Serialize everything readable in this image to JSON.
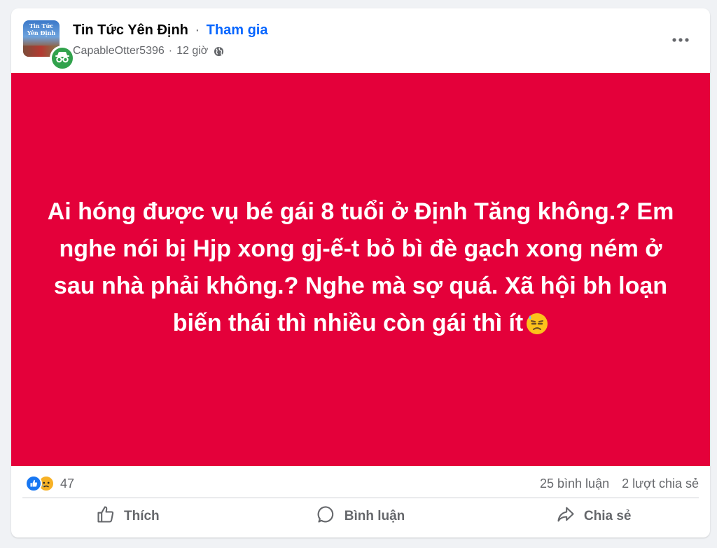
{
  "header": {
    "group_name": "Tin Tức Yên Định",
    "separator": "·",
    "join_label": "Tham gia",
    "group_avatar_text": "Tin Tức Yên Định",
    "author": "CapableOtter5396",
    "time": "12 giờ",
    "author_avatar_icon": "anonymous-incognito-icon",
    "privacy_icon": "globe-icon",
    "more_icon": "more-horizontal-icon"
  },
  "post": {
    "lines": [
      "Ai hóng được vụ bé gái 8 tuổi ở Định Tăng không.? Em",
      "nghe nói bị Hjp xong gj-ế-t bỏ bì đè gạch xong ném ở",
      "sau nhà phải không.? Nghe mà sợ quá. Xã hội bh loạn",
      "biến thái thì nhiều còn gái thì ít"
    ],
    "emoji": "downcast-face-with-sweat-emoji",
    "background_color": "#e4003a"
  },
  "stats": {
    "reaction_icons": [
      "like-icon",
      "sad-icon"
    ],
    "reaction_count": "47",
    "comments": "25 bình luận",
    "shares": "2 lượt chia sẻ"
  },
  "actions": {
    "like": "Thích",
    "comment": "Bình luận",
    "share": "Chia sẻ"
  },
  "colors": {
    "accent": "#0866ff",
    "secondary_text": "#65676b",
    "page_background": "#f0f2f5"
  }
}
